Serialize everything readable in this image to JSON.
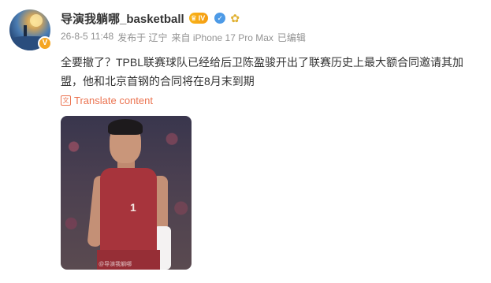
{
  "post": {
    "author": "导演我躺哪_basketball",
    "level_label": "IV",
    "verified_mark": "V",
    "date": "26-8-5 11:48",
    "location": "发布于 辽宁",
    "device": "来自 iPhone 17 Pro Max",
    "edited": "已编辑",
    "text": "全要撤了？TPBL联赛球队已经给后卫陈盈骏开出了联赛历史上最大额合同邀请其加盟，他和北京首钢的合同将在8月末到期",
    "translate_label": "Translate content",
    "image_watermark": "@导演我躺哪",
    "jersey_number": "1"
  },
  "icons": {
    "crown": "crown-icon",
    "shield": "shield-icon",
    "flower": "flower-icon",
    "translate": "translate-icon"
  },
  "colors": {
    "link": "#eb7350",
    "name": "#333333",
    "meta": "#939393",
    "badge": "#f5a623",
    "jersey": "#a7343c"
  }
}
